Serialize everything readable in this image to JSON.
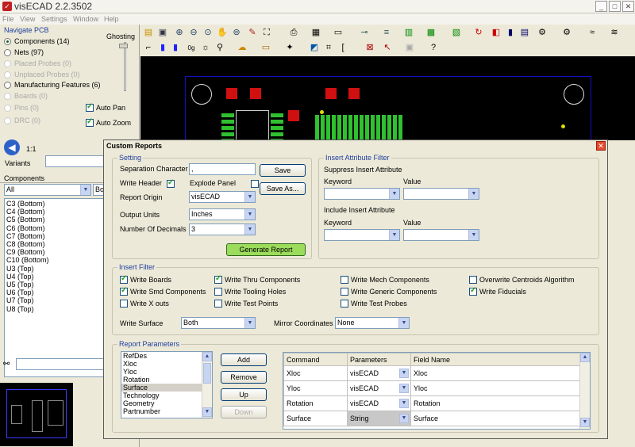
{
  "app": {
    "title": "visECAD 2.2.3502"
  },
  "window_controls": {
    "minimize": "_",
    "maximize": "□",
    "close": "✕"
  },
  "menu": [
    "File",
    "View",
    "Settings",
    "Window",
    "Help"
  ],
  "navigate": {
    "title": "Navigate PCB",
    "ghosting_label": "Ghosting",
    "items": [
      {
        "label": "Components (14)",
        "selected": true,
        "enabled": true
      },
      {
        "label": "Nets (97)",
        "selected": false,
        "enabled": true
      },
      {
        "label": "Placed Probes (0)",
        "selected": false,
        "enabled": false
      },
      {
        "label": "Unplaced Probes (0)",
        "selected": false,
        "enabled": false
      },
      {
        "label": "Manufacturing Features (6)",
        "selected": false,
        "enabled": true
      },
      {
        "label": "Boards (0)",
        "selected": false,
        "enabled": false
      },
      {
        "label": "Pins (0)",
        "selected": false,
        "enabled": false
      },
      {
        "label": "DRC (0)",
        "selected": false,
        "enabled": false
      }
    ],
    "auto_pan": "Auto Pan",
    "auto_zoom": "Auto Zoom",
    "zoom_ratio": "1:1",
    "variants_label": "Variants",
    "components_header": "Components",
    "filter_value": "All",
    "filter_value2": "Bo",
    "component_list": [
      "C3 (Bottom)",
      "C4 (Bottom)",
      "C5 (Bottom)",
      "C6 (Bottom)",
      "C7 (Bottom)",
      "C8 (Bottom)",
      "C9 (Bottom)",
      "C10 (Bottom)",
      "U3 (Top)",
      "U4 (Top)",
      "U5 (Top)",
      "U6 (Top)",
      "U7 (Top)",
      "U8 (Top)"
    ]
  },
  "dialog": {
    "title": "Custom Reports",
    "close": "✕",
    "setting": {
      "title": "Setting",
      "separation_label": "Separation Character",
      "separation_value": ",",
      "save_label": "Save",
      "write_header_label": "Write Header",
      "explode_panel_label": "Explode Panel",
      "save_as_label": "Save As...",
      "report_origin_label": "Report Origin",
      "report_origin_value": "visECAD",
      "output_units_label": "Output Units",
      "output_units_value": "Inches",
      "decimals_label": "Number Of Decimals",
      "decimals_value": "3",
      "generate_label": "Generate Report"
    },
    "attr_filter": {
      "title": "Insert Attribute Filter",
      "suppress_label": "Suppress Insert Attribute",
      "include_label": "Include Insert Attribute",
      "keyword_label": "Keyword",
      "value_label": "Value"
    },
    "insert_filter": {
      "title": "Insert Filter",
      "checkboxes": [
        {
          "label": "Write Boards",
          "checked": true
        },
        {
          "label": "Write Thru Components",
          "checked": true
        },
        {
          "label": "Write Mech Components",
          "checked": false
        },
        {
          "label": "Overwrite Centroids Algorithm",
          "checked": false
        },
        {
          "label": "Write Smd Components",
          "checked": true
        },
        {
          "label": "Write Tooling Holes",
          "checked": false
        },
        {
          "label": "Write Generic Components",
          "checked": false
        },
        {
          "label": "Write Fiducials",
          "checked": true
        },
        {
          "label": "Write X outs",
          "checked": false
        },
        {
          "label": "Write Test Points",
          "checked": false
        },
        {
          "label": "Write Test Probes",
          "checked": false
        }
      ],
      "write_surface_label": "Write Surface",
      "write_surface_value": "Both",
      "mirror_label": "Mirror Coordinates",
      "mirror_value": "None"
    },
    "params": {
      "title": "Report Parameters",
      "list": [
        "RefDes",
        "Xloc",
        "Yloc",
        "Rotation",
        "Surface",
        "Technology",
        "Geometry",
        "Partnumber"
      ],
      "selected_index": 4,
      "add_label": "Add",
      "remove_label": "Remove",
      "up_label": "Up",
      "down_label": "Down",
      "headers": [
        "Command",
        "Parameters",
        "Field Name"
      ],
      "rows": [
        {
          "command": "Xloc",
          "param": "visECAD",
          "field": "Xloc"
        },
        {
          "command": "Yloc",
          "param": "visECAD",
          "field": "Yloc"
        },
        {
          "command": "Rotation",
          "param": "visECAD",
          "field": "Rotation"
        },
        {
          "command": "Surface",
          "param": "String",
          "field": "Surface"
        }
      ]
    }
  },
  "colors": {
    "board_outline": "#1010c0",
    "pad": "#d01010",
    "pad_green": "#30c030",
    "generate_button": "#9cdc5c",
    "group_title": "#1f3f9f"
  }
}
